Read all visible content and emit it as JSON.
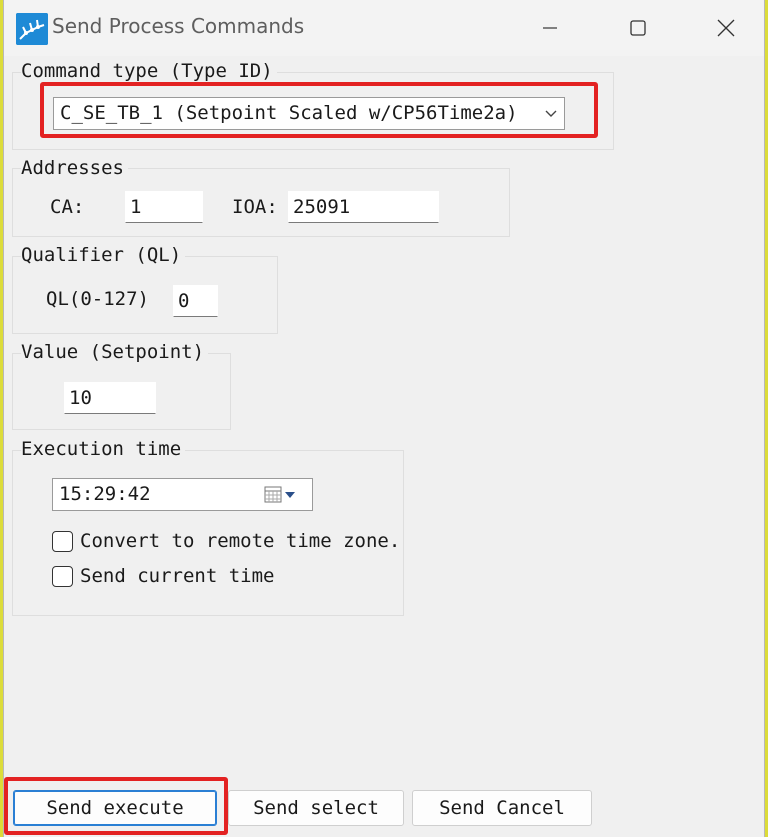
{
  "window": {
    "title": "Send Process Commands",
    "minimize_icon": "minimize-icon",
    "maximize_icon": "maximize-icon",
    "close_icon": "close-icon"
  },
  "command_type": {
    "legend": "Command type (Type ID)",
    "selected": "C_SE_TB_1  (Setpoint Scaled w/CP56Time2a)",
    "dropdown_icon": "chevron-down-icon"
  },
  "addresses": {
    "legend": "Addresses",
    "ca_label": "CA:",
    "ca_value": "1",
    "ioa_label": "IOA:",
    "ioa_value": "25091"
  },
  "qualifier": {
    "legend": "Qualifier (QL)",
    "ql_label": "QL(0-127)",
    "ql_value": "0"
  },
  "value": {
    "legend": "Value (Setpoint)",
    "setpoint_value": "10"
  },
  "execution_time": {
    "legend": "Execution time",
    "time_value": "15:29:42",
    "calendar_icon": "calendar-icon",
    "convert_label": "Convert to remote time zone.",
    "convert_checked": false,
    "send_current_label": "Send current time",
    "send_current_checked": false
  },
  "buttons": {
    "send_execute": "Send execute",
    "send_select": "Send select",
    "send_cancel": "Send Cancel"
  },
  "colors": {
    "highlight": "#e32222",
    "accent": "#2a7fd4",
    "app_icon": "#1e8ad6"
  }
}
